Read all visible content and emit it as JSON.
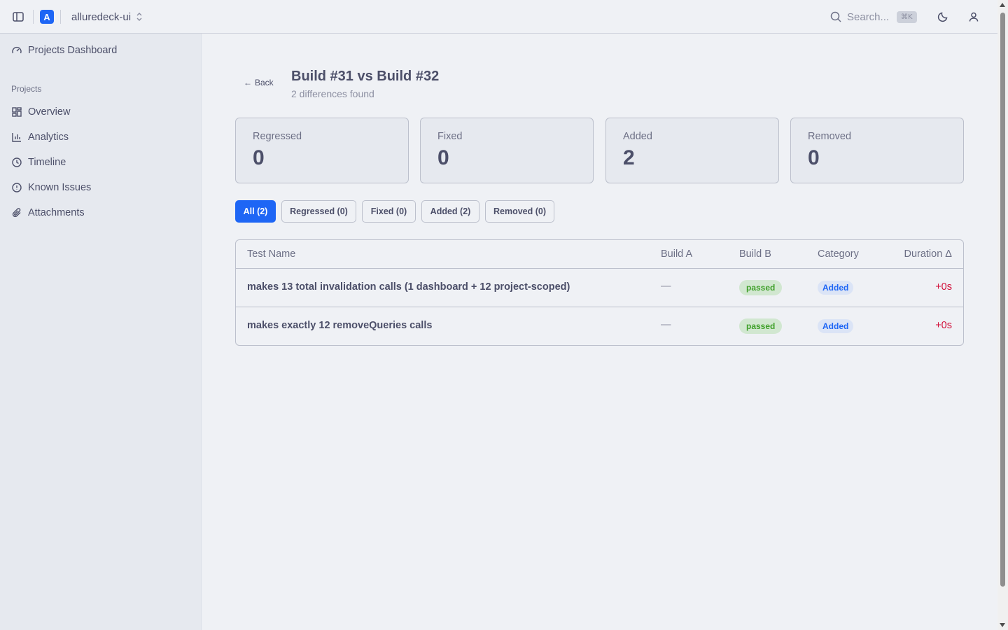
{
  "topbar": {
    "logo_letter": "A",
    "project_name": "alluredeck-ui",
    "search_placeholder": "Search...",
    "search_shortcut": "⌘K"
  },
  "sidebar": {
    "dashboard_label": "Projects Dashboard",
    "section_label": "Projects",
    "items": [
      {
        "label": "Overview",
        "icon": "grid-icon"
      },
      {
        "label": "Analytics",
        "icon": "bar-chart-icon"
      },
      {
        "label": "Timeline",
        "icon": "clock-icon"
      },
      {
        "label": "Known Issues",
        "icon": "alert-circle-icon"
      },
      {
        "label": "Attachments",
        "icon": "paperclip-icon"
      }
    ]
  },
  "main": {
    "back_label": "Back",
    "title": "Build #31 vs Build #32",
    "subtitle": "2 differences found",
    "stats": [
      {
        "label": "Regressed",
        "value": "0"
      },
      {
        "label": "Fixed",
        "value": "0"
      },
      {
        "label": "Added",
        "value": "2"
      },
      {
        "label": "Removed",
        "value": "0"
      }
    ],
    "filters": [
      {
        "label": "All (2)",
        "active": true
      },
      {
        "label": "Regressed (0)",
        "active": false
      },
      {
        "label": "Fixed (0)",
        "active": false
      },
      {
        "label": "Added (2)",
        "active": false
      },
      {
        "label": "Removed (0)",
        "active": false
      }
    ],
    "table": {
      "headers": [
        "Test Name",
        "Build A",
        "Build B",
        "Category",
        "Duration Δ"
      ],
      "rows": [
        {
          "name": "makes 13 total invalidation calls (1 dashboard + 12 project-scoped)",
          "build_a": "—",
          "build_b": "passed",
          "category": "Added",
          "duration": "+0s"
        },
        {
          "name": "makes exactly 12 removeQueries calls",
          "build_a": "—",
          "build_b": "passed",
          "category": "Added",
          "duration": "+0s"
        }
      ]
    }
  },
  "colors": {
    "accent": "#1e66f5",
    "passed": "#40a02b",
    "duration_positive": "#d20f39"
  }
}
